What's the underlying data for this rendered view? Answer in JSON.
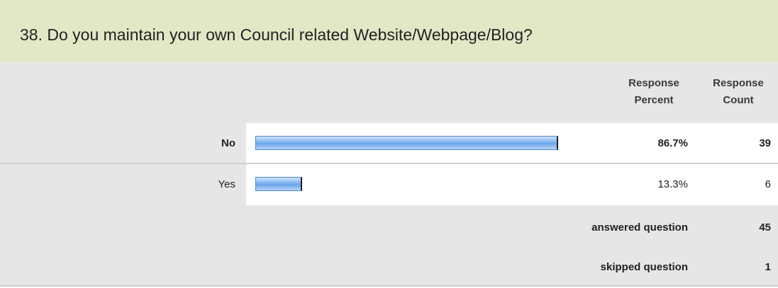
{
  "question": {
    "title": "38. Do you maintain your own Council related Website/Webpage/Blog?"
  },
  "headers": {
    "response_percent_line1": "Response",
    "response_percent_line2": "Percent",
    "response_count_line1": "Response",
    "response_count_line2": "Count"
  },
  "rows": [
    {
      "label": "No",
      "percent": "86.7%",
      "count": "39"
    },
    {
      "label": "Yes",
      "percent": "13.3%",
      "count": "6"
    }
  ],
  "summary": {
    "answered_label": "answered question",
    "answered_value": "45",
    "skipped_label": "skipped question",
    "skipped_value": "1"
  },
  "chart_data": {
    "type": "bar",
    "orientation": "horizontal",
    "categories": [
      "No",
      "Yes"
    ],
    "values": [
      86.7,
      13.3
    ],
    "counts": [
      39,
      6
    ],
    "xlim": [
      0,
      100
    ],
    "bar_color": "#7eb2f0"
  }
}
